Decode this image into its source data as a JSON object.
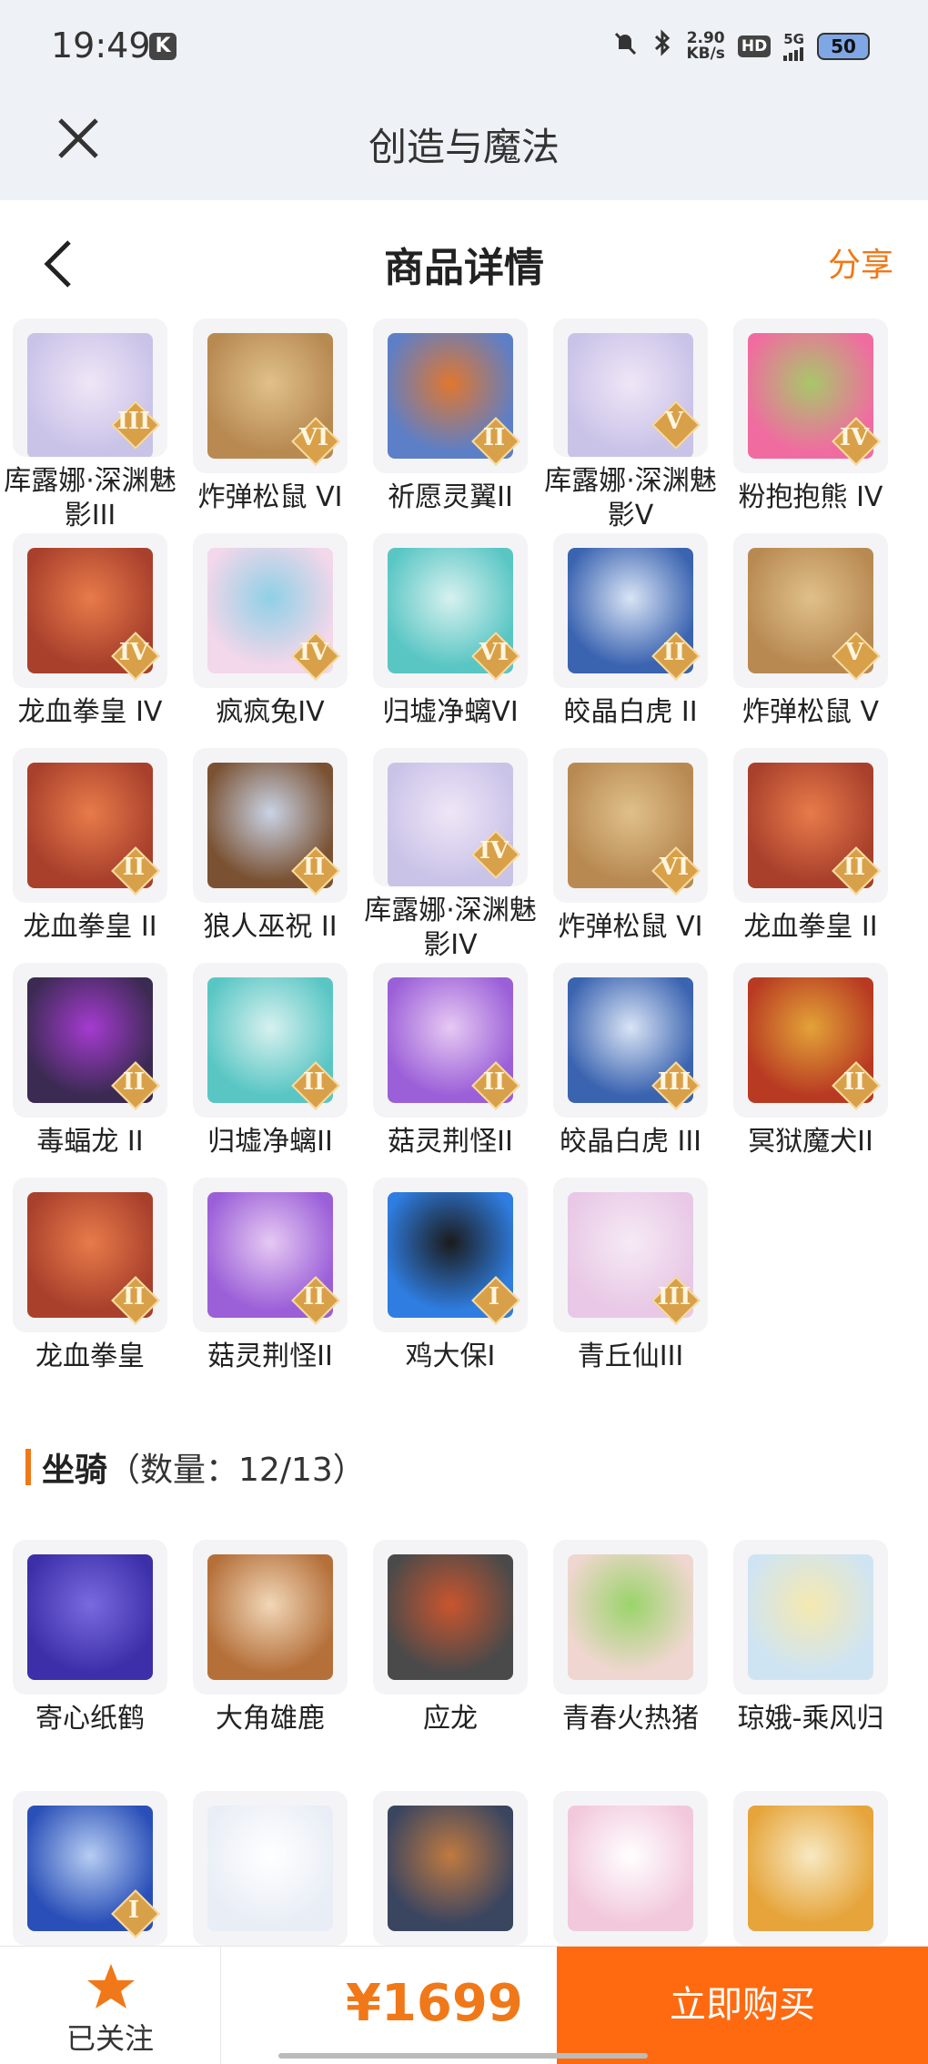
{
  "status": {
    "time": "19:49",
    "k": "K",
    "speed_top": "2.90",
    "speed_bottom": "KB/s",
    "hd": "HD",
    "net": "5G",
    "battery": "50"
  },
  "app": {
    "title": "创造与魔法"
  },
  "nav": {
    "title": "商品详情",
    "share": "分享"
  },
  "characters": [
    {
      "name": "库露娜·深渊魅影III",
      "rank": "III",
      "colors": [
        "#c9c3e8",
        "#f0e6f7"
      ]
    },
    {
      "name": "炸弹松鼠 VI",
      "rank": "VI",
      "colors": [
        "#b88a52",
        "#e0c08a"
      ]
    },
    {
      "name": "祈愿灵翼II",
      "rank": "II",
      "colors": [
        "#5d7fc7",
        "#e0772f"
      ]
    },
    {
      "name": "库露娜·深渊魅影V",
      "rank": "V",
      "colors": [
        "#c9c3e8",
        "#f0e6f7"
      ]
    },
    {
      "name": "粉抱抱熊 IV",
      "rank": "IV",
      "colors": [
        "#f06ca0",
        "#a8c76a"
      ]
    },
    {
      "name": "龙血拳皇 IV",
      "rank": "IV",
      "colors": [
        "#a8402c",
        "#e87b4a"
      ]
    },
    {
      "name": "疯疯兔IV",
      "rank": "IV",
      "colors": [
        "#f3d7ea",
        "#8fd0e6"
      ]
    },
    {
      "name": "归墟净螭VI",
      "rank": "VI",
      "colors": [
        "#59c6c4",
        "#d7f1ef"
      ]
    },
    {
      "name": "皎晶白虎 II",
      "rank": "II",
      "colors": [
        "#3a63b0",
        "#d9e4f5"
      ]
    },
    {
      "name": "炸弹松鼠 V",
      "rank": "V",
      "colors": [
        "#b88a52",
        "#e0c08a"
      ]
    },
    {
      "name": "龙血拳皇 II",
      "rank": "II",
      "colors": [
        "#a8402c",
        "#e87b4a"
      ]
    },
    {
      "name": "狼人巫祝 II",
      "rank": "II",
      "colors": [
        "#7a5233",
        "#c9d3e6"
      ]
    },
    {
      "name": "库露娜·深渊魅影IV",
      "rank": "IV",
      "colors": [
        "#c9c3e8",
        "#f0e6f7"
      ]
    },
    {
      "name": "炸弹松鼠 VI",
      "rank": "VI",
      "colors": [
        "#b88a52",
        "#e0c08a"
      ]
    },
    {
      "name": "龙血拳皇 II",
      "rank": "II",
      "colors": [
        "#a8402c",
        "#e87b4a"
      ]
    },
    {
      "name": "毒蝠龙 II",
      "rank": "II",
      "colors": [
        "#3b2a52",
        "#a53bd0"
      ]
    },
    {
      "name": "归墟净螭II",
      "rank": "II",
      "colors": [
        "#59c6c4",
        "#d7f1ef"
      ]
    },
    {
      "name": "菇灵荆怪II",
      "rank": "II",
      "colors": [
        "#9b5fd8",
        "#e6c9f3"
      ]
    },
    {
      "name": "皎晶白虎 III",
      "rank": "III",
      "colors": [
        "#3a63b0",
        "#d9e4f5"
      ]
    },
    {
      "name": "冥狱魔犬II",
      "rank": "II",
      "colors": [
        "#b83a22",
        "#e3a338"
      ]
    },
    {
      "name": "龙血拳皇",
      "rank": "II",
      "colors": [
        "#a8402c",
        "#e87b4a"
      ]
    },
    {
      "name": "菇灵荆怪II",
      "rank": "II",
      "colors": [
        "#9b5fd8",
        "#e6c9f3"
      ]
    },
    {
      "name": "鸡大保I",
      "rank": "I",
      "colors": [
        "#2f7de0",
        "#1b1b1b"
      ]
    },
    {
      "name": "青丘仙III",
      "rank": "III",
      "colors": [
        "#e8c8e6",
        "#f6eaf4"
      ]
    }
  ],
  "mount_section": {
    "title": "坐骑",
    "count": "（数量：12/13）"
  },
  "mounts": [
    {
      "name": "寄心纸鹤",
      "rank": "",
      "colors": [
        "#3c2fa8",
        "#7a6ae0"
      ]
    },
    {
      "name": "大角雄鹿",
      "rank": "",
      "colors": [
        "#b5703a",
        "#f1d7b8"
      ]
    },
    {
      "name": "应龙",
      "rank": "",
      "colors": [
        "#4a4a4a",
        "#c9552e"
      ]
    },
    {
      "name": "青春火热猪",
      "rank": "",
      "colors": [
        "#f0d6d0",
        "#9ad46a"
      ]
    },
    {
      "name": "琼娥-乘风归",
      "rank": "",
      "colors": [
        "#cfe4f3",
        "#f5e9b0"
      ]
    },
    {
      "name": "",
      "rank": "I",
      "colors": [
        "#2a4fb8",
        "#b6cdf2"
      ]
    },
    {
      "name": "",
      "rank": "",
      "colors": [
        "#e9eef6",
        "#ffffff"
      ]
    },
    {
      "name": "",
      "rank": "",
      "colors": [
        "#3a4560",
        "#c07a40"
      ]
    },
    {
      "name": "",
      "rank": "",
      "colors": [
        "#f2c8dc",
        "#ffffff"
      ]
    },
    {
      "name": "",
      "rank": "",
      "colors": [
        "#e6a43a",
        "#f7e9c2"
      ]
    }
  ],
  "bottom": {
    "follow": "已关注",
    "price": "¥1699",
    "buy": "立即购买"
  },
  "colors": {
    "accent": "#f07818",
    "buy_bg": "#ff6a10",
    "header_bg": "#eef1f5"
  }
}
